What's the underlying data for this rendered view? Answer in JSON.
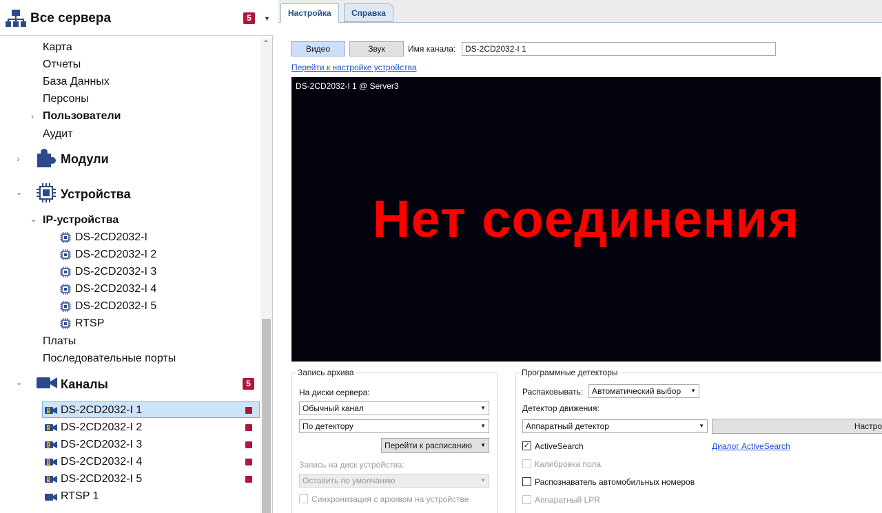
{
  "server_header": {
    "title": "Все сервера",
    "badge": "5"
  },
  "tree": {
    "top_items": [
      "Карта",
      "Отчеты",
      "База Данных",
      "Персоны"
    ],
    "users": "Пользователи",
    "audit": "Аудит",
    "modules": "Модули",
    "devices": "Устройства",
    "ip_devices": "IP-устройства",
    "ip_device_list": [
      "DS-2CD2032-I",
      "DS-2CD2032-I 2",
      "DS-2CD2032-I 3",
      "DS-2CD2032-I 4",
      "DS-2CD2032-I 5",
      "RTSP"
    ],
    "boards": "Платы",
    "serial_ports": "Последовательные порты",
    "channels": "Каналы",
    "channels_badge": "5",
    "channel_list": [
      "DS-2CD2032-I 1",
      "DS-2CD2032-I 2",
      "DS-2CD2032-I 3",
      "DS-2CD2032-I 4",
      "DS-2CD2032-I 5",
      "RTSP 1"
    ]
  },
  "tabs": {
    "settings": "Настройка",
    "help": "Справка"
  },
  "toolbar": {
    "video": "Видео",
    "sound": "Звук",
    "channel_name_label": "Имя канала:",
    "channel_name_value": "DS-2CD2032-I 1",
    "device_link": "Перейти к настройке устройства"
  },
  "video": {
    "caption": "DS-2CD2032-I 1 @ Server3",
    "status": "Нет соединения"
  },
  "archive": {
    "title": "Запись архива",
    "server_disks_label": "На диски сервера:",
    "mode": "Обычный канал",
    "trigger": "По детектору",
    "schedule_button": "Перейти к расписанию",
    "device_disk_label": "Запись на диск устройства:",
    "device_default": "Оставить по умолчанию",
    "sync_label": "Синхронизация с архивом на устройстве"
  },
  "detectors": {
    "title": "Программные детекторы",
    "unpack_label": "Распаковывать:",
    "unpack_value": "Автоматический выбор",
    "motion_label": "Детектор движения:",
    "motion_value": "Аппаратный детектор",
    "settings_button": "Настро",
    "activesearch_label": "ActiveSearch",
    "activesearch_checked": true,
    "activesearch_link": "Диалог ActiveSearch",
    "floor_calibration": "Калибровка пола",
    "lpr_label": "Распознаватель автомобильных номеров",
    "hw_lpr": "Аппаратный LPR"
  }
}
